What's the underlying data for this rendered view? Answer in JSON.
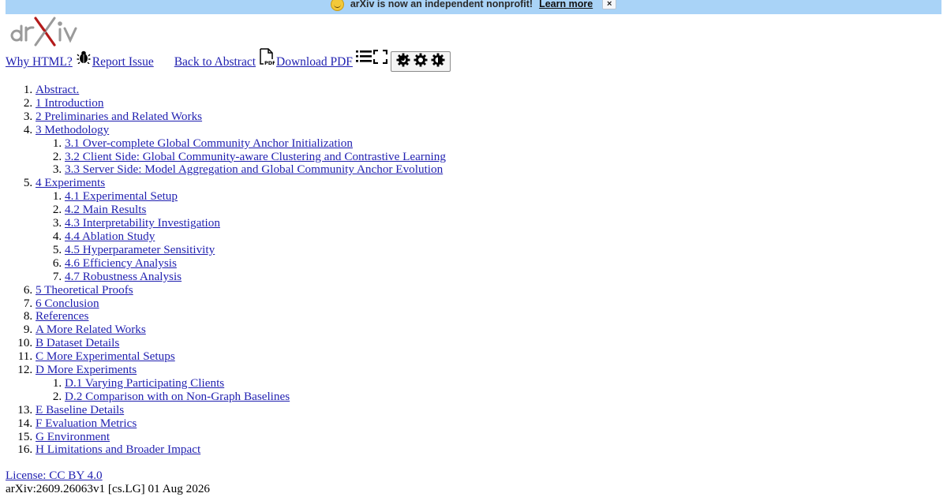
{
  "banner": {
    "message": "arXiv is now an independent nonprofit!",
    "learn_more": "Learn more",
    "close": "×"
  },
  "logo": {
    "text": "arXiv"
  },
  "toolbar": {
    "why_html": "Why HTML?",
    "report_issue": "Report Issue",
    "back_to_abstract": "Back to Abstract",
    "download_pdf": "Download PDF"
  },
  "toc": [
    {
      "label": "Abstract.",
      "children": []
    },
    {
      "label": "1 Introduction",
      "children": []
    },
    {
      "label": "2 Preliminaries and Related Works",
      "children": []
    },
    {
      "label": "3 Methodology",
      "children": [
        "3.1 Over-complete Global Community Anchor Initialization",
        "3.2 Client Side: Global Community-aware Clustering and Contrastive Learning",
        "3.3 Server Side: Model Aggregation and Global Community Anchor Evolution"
      ]
    },
    {
      "label": "4 Experiments",
      "children": [
        "4.1 Experimental Setup",
        "4.2 Main Results",
        "4.3 Interpretability Investigation",
        "4.4 Ablation Study",
        "4.5 Hyperparameter Sensitivity",
        "4.6 Efficiency Analysis",
        "4.7 Robustness Analysis"
      ]
    },
    {
      "label": "5 Theoretical Proofs",
      "children": []
    },
    {
      "label": "6 Conclusion",
      "children": []
    },
    {
      "label": "References",
      "children": []
    },
    {
      "label": "A More Related Works",
      "children": []
    },
    {
      "label": "B Dataset Details",
      "children": []
    },
    {
      "label": "C More Experimental Setups",
      "children": []
    },
    {
      "label": "D More Experiments",
      "children": [
        "D.1 Varying Participating Clients",
        "D.2 Comparison with on Non-Graph Baselines"
      ]
    },
    {
      "label": "E Baseline Details",
      "children": []
    },
    {
      "label": "F Evaluation Metrics",
      "children": []
    },
    {
      "label": "G Environment",
      "children": []
    },
    {
      "label": "H Limitations and Broader Impact",
      "children": []
    }
  ],
  "footer": {
    "license": "License: CC BY 4.0",
    "arxiv_id": "arXiv:2609.26063v1 [cs.LG] 01 Aug 2026"
  },
  "icons": {
    "banner_emoji": "smiling-face-icon",
    "report": "bug-icon",
    "pdf": "pdf-file-icon",
    "toc_toggle": "list-icon",
    "fullscreen": "expand-icon",
    "theme_dark": "gear-dark-icon",
    "theme_auto": "gear-outline-icon",
    "theme_contrast": "contrast-gear-icon"
  },
  "colors": {
    "banner_bg": "#a9d3f7",
    "link": "#1f1fb0",
    "logo_x": "#b31b1b",
    "logo_text": "#9a9a9a"
  }
}
